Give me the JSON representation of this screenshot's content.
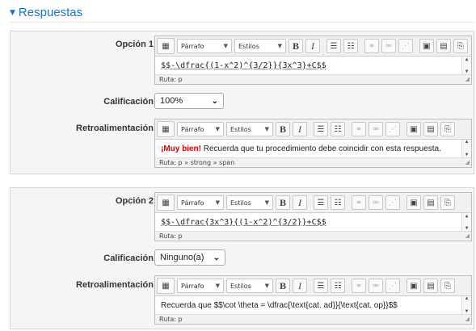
{
  "section": {
    "title": "Respuestas"
  },
  "toolbar": {
    "paragraph": "Párrafo",
    "styles": "Estilos",
    "bold": "B",
    "italic": "I"
  },
  "answers": [
    {
      "option_label": "Opción 1",
      "option_text": "$$-\\dfrac{(1-x^2)^{3/2}}{3x^3}+C$$",
      "option_path": "Ruta: p",
      "grade_label": "Calificación",
      "grade_value": "100%",
      "feedback_label": "Retroalimentación",
      "feedback_strong": "¡Muy bien!",
      "feedback_text": " Recuerda que tu procedimiento debe coincidir con esta respuesta.",
      "feedback_path": "Ruta: p » strong » span"
    },
    {
      "option_label": "Opción 2",
      "option_text": "$$-\\dfrac{3x^3}{(1-x^2)^{3/2}}+C$$",
      "option_path": "Ruta: p",
      "grade_label": "Calificación",
      "grade_value": "Ninguno(a)",
      "feedback_label": "Retroalimentación",
      "feedback_text": "Recuerda que $$\\cot \\theta = \\dfrac{\\text{cat. ad}}{\\text{cat. op}}$$",
      "feedback_path": "Ruta: p"
    }
  ],
  "icons": {
    "caret": "caret-down-icon",
    "toggle": "toolbar-toggle-icon",
    "ul": "bullet-list-icon",
    "ol": "numbered-list-icon",
    "link": "link-icon",
    "unlink": "unlink-icon",
    "image": "image-icon",
    "media": "media-icon",
    "files": "file-manager-icon"
  },
  "colors": {
    "accent": "#1177d1",
    "strong": "#d40000"
  }
}
